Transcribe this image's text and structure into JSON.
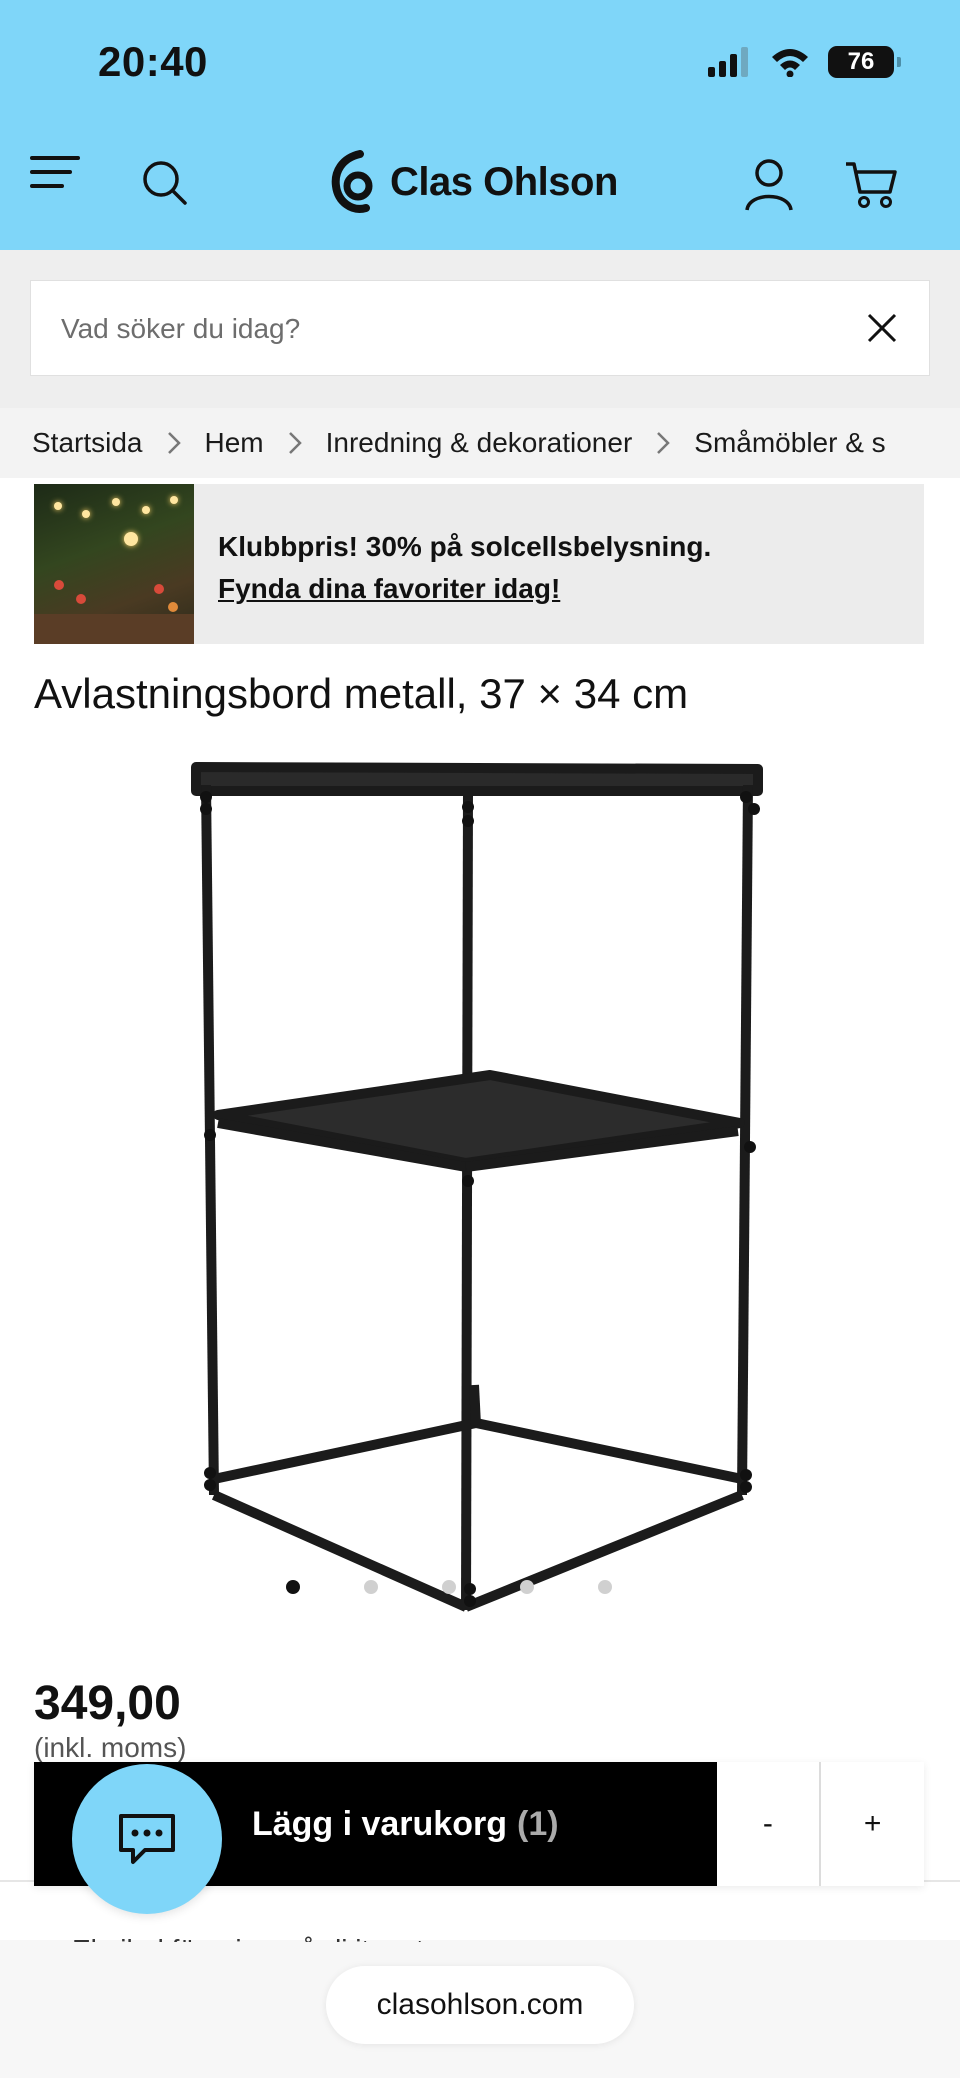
{
  "status_bar": {
    "time": "20:40",
    "battery": "76"
  },
  "header": {
    "brand": "Clas Ohlson"
  },
  "search": {
    "placeholder": "Vad söker du idag?"
  },
  "breadcrumb": [
    "Startsida",
    "Hem",
    "Inredning & dekorationer",
    "Småmöbler & s"
  ],
  "promo": {
    "headline": "Klubbpris! 30% på solcellsbelysning.",
    "link": "Fynda dina favoriter idag!"
  },
  "product": {
    "title": "Avlastningsbord metall, 37 × 34 cm",
    "price": "349,00",
    "vat_note": "(inkl. moms)",
    "image_count": 5,
    "active_image": 1
  },
  "cart": {
    "add_label": "Lägg i varukorg",
    "count": "(1)",
    "minus": "-",
    "plus": "+"
  },
  "partial_text": "Ebvilad föreningsvårdi item t",
  "browser": {
    "url": "clasohlson.com"
  },
  "colors": {
    "header_bg": "#7fd6f9",
    "button_bg": "#000000",
    "chat_bg": "#7fd6f9"
  },
  "icons": [
    "menu-icon",
    "search-icon",
    "account-icon",
    "cart-icon",
    "clear-icon",
    "chevron-right-icon",
    "chat-icon"
  ]
}
